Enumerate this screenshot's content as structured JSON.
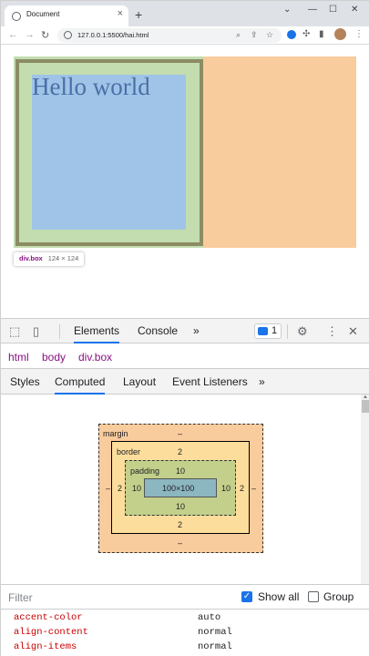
{
  "browser": {
    "tab_title": "Document",
    "tab_close": "×",
    "new_tab": "+",
    "url": "127.0.0.1:5500/hai.html"
  },
  "page": {
    "heading": "Hello world",
    "colors": {
      "element_margin": "#c3ddb0",
      "element_border": "#8c8c64",
      "element_content": "#9fc4e7",
      "sibling_box": "#f9cc9d"
    },
    "tooltip": {
      "selector": "div.box",
      "size": "124 × 124"
    }
  },
  "devtools": {
    "tabs": [
      {
        "label": "Elements"
      },
      {
        "label": "Console"
      }
    ],
    "more": "»",
    "issues_count": "1",
    "breadcrumb": [
      {
        "label": "html"
      },
      {
        "label": "body"
      },
      {
        "label": "div.box"
      }
    ],
    "subtabs": [
      {
        "label": "Styles"
      },
      {
        "label": "Computed"
      },
      {
        "label": "Layout"
      },
      {
        "label": "Event Listeners"
      }
    ],
    "subtabs_more": "»",
    "active_subtab": "Computed",
    "box_model": {
      "margin_label": "margin",
      "margin_top": "–",
      "margin_right": "–",
      "margin_bottom": "–",
      "margin_left": "–",
      "border_label": "border",
      "border_top": "2",
      "border_right": "2",
      "border_bottom": "2",
      "border_left": "2",
      "padding_label": "padding",
      "padding_top": "10",
      "padding_right": "10",
      "padding_bottom": "10",
      "padding_left": "10",
      "content": "100×100"
    },
    "filter_placeholder": "Filter",
    "show_all_label": "Show all",
    "show_all_checked": true,
    "group_label": "Group",
    "group_checked": false,
    "properties": [
      {
        "name": "accent-color",
        "value": "auto"
      },
      {
        "name": "align-content",
        "value": "normal"
      },
      {
        "name": "align-items",
        "value": "normal"
      }
    ]
  }
}
